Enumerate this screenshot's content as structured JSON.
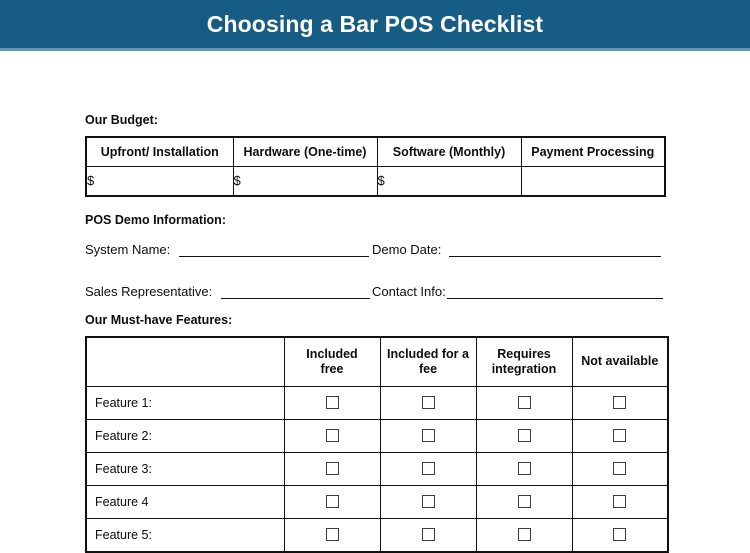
{
  "header": {
    "title": "Choosing a Bar POS Checklist",
    "background_color": "#175C84",
    "underline_color": "#5E9AB8",
    "text_color": "#FFFFFF"
  },
  "budget": {
    "label": "Our Budget:",
    "columns": [
      "Upfront/ Installation",
      "Hardware (One-time)",
      "Software (Monthly)",
      "Payment Processing"
    ],
    "values": [
      "$",
      "$",
      "$",
      ""
    ]
  },
  "demo_info": {
    "label": "POS Demo Information:",
    "fields": [
      {
        "label": "System Name:",
        "value": ""
      },
      {
        "label": "Demo Date:",
        "value": ""
      },
      {
        "label": "Sales Representative:",
        "value": ""
      },
      {
        "label": "Contact Info:",
        "value": ""
      }
    ]
  },
  "features": {
    "label": "Our Must-have Features:",
    "row_header": "",
    "columns": [
      "Included free",
      "Included for a fee",
      "Requires integration",
      "Not available"
    ],
    "column_lines": [
      [
        "Included",
        "free"
      ],
      [
        "Included for a",
        "fee"
      ],
      [
        "Requires",
        "integration"
      ],
      [
        "Not available",
        ""
      ]
    ],
    "rows": [
      {
        "name": "Feature 1:",
        "checks": [
          false,
          false,
          false,
          false
        ]
      },
      {
        "name": "Feature 2:",
        "checks": [
          false,
          false,
          false,
          false
        ]
      },
      {
        "name": "Feature 3:",
        "checks": [
          false,
          false,
          false,
          false
        ]
      },
      {
        "name": "Feature 4",
        "checks": [
          false,
          false,
          false,
          false
        ]
      },
      {
        "name": "Feature 5:",
        "checks": [
          false,
          false,
          false,
          false
        ]
      }
    ]
  }
}
